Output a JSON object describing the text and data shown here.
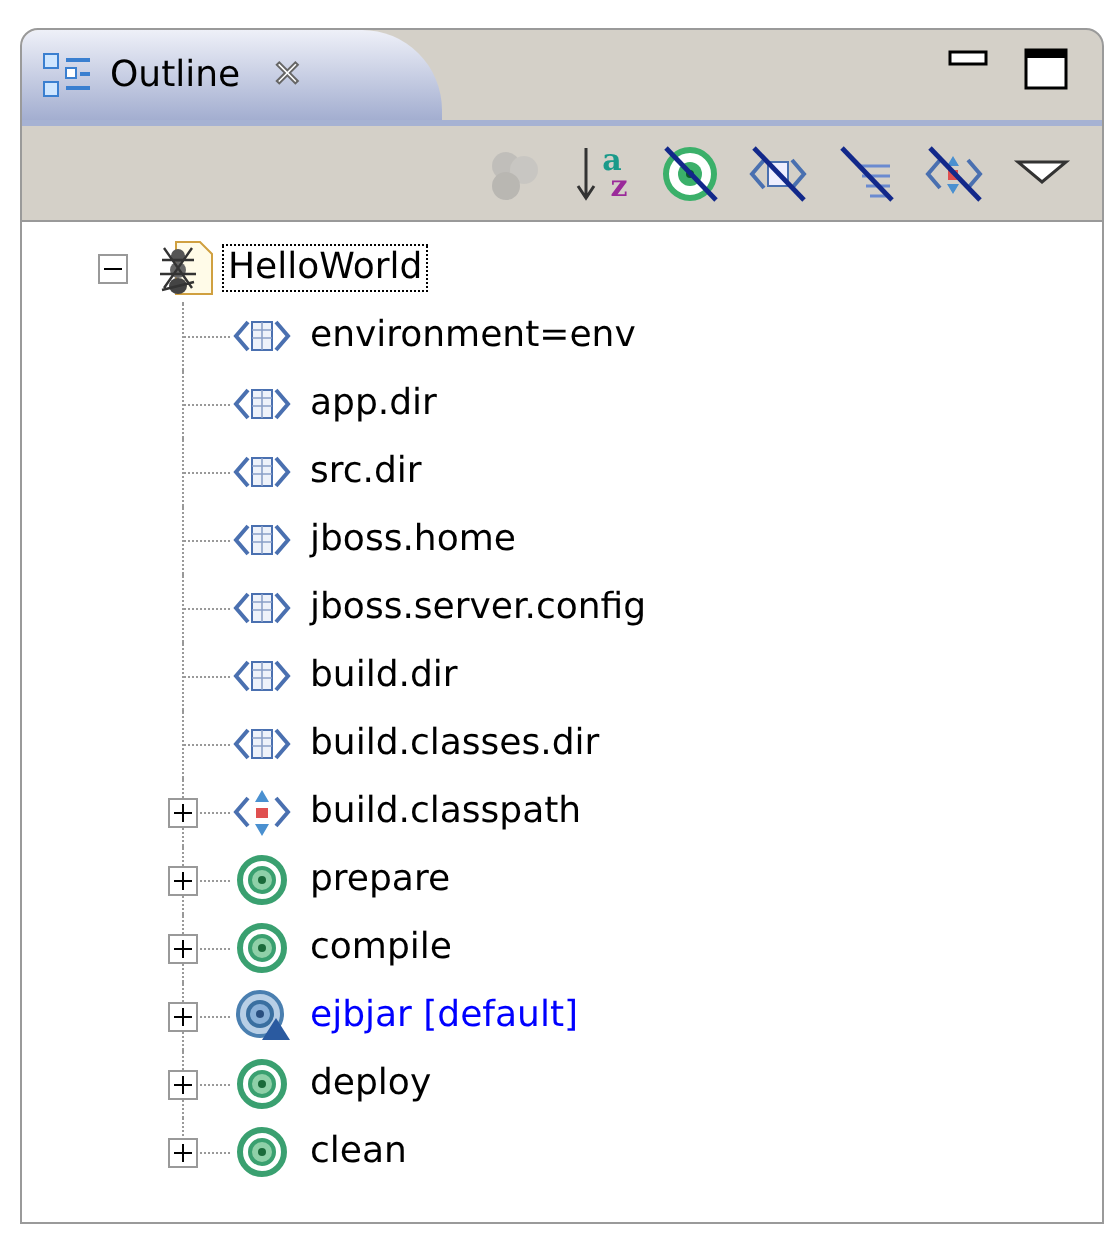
{
  "view": {
    "tab": {
      "title": "Outline",
      "selected": true,
      "close": "✕"
    }
  },
  "toolbar": [
    {
      "kind": "show_imports",
      "disabled": true
    },
    {
      "kind": "sort",
      "disabled": false,
      "top": "a",
      "bottom": "z"
    },
    {
      "kind": "hide_targets",
      "disabled": false
    },
    {
      "kind": "hide_properties",
      "disabled": false
    },
    {
      "kind": "hide_internal",
      "disabled": false
    },
    {
      "kind": "hide_paths",
      "disabled": false
    },
    {
      "kind": "menu",
      "disabled": false
    }
  ],
  "tree": {
    "label": "HelloWorld",
    "expanded": true,
    "selected": true,
    "children": [
      {
        "kind": "property",
        "label": "environment=env"
      },
      {
        "kind": "property",
        "label": "app.dir"
      },
      {
        "kind": "property",
        "label": "src.dir"
      },
      {
        "kind": "property",
        "label": "jboss.home"
      },
      {
        "kind": "property",
        "label": "jboss.server.config"
      },
      {
        "kind": "property",
        "label": "build.dir"
      },
      {
        "kind": "property",
        "label": "build.classes.dir"
      },
      {
        "kind": "path",
        "label": "build.classpath",
        "expanded": false
      },
      {
        "kind": "target",
        "label": "prepare",
        "expanded": false
      },
      {
        "kind": "target",
        "label": "compile",
        "expanded": false
      },
      {
        "kind": "default_target",
        "label": "ejbjar [default]",
        "expanded": false
      },
      {
        "kind": "target",
        "label": "deploy",
        "expanded": false
      },
      {
        "kind": "target",
        "label": "clean",
        "expanded": false
      }
    ]
  }
}
